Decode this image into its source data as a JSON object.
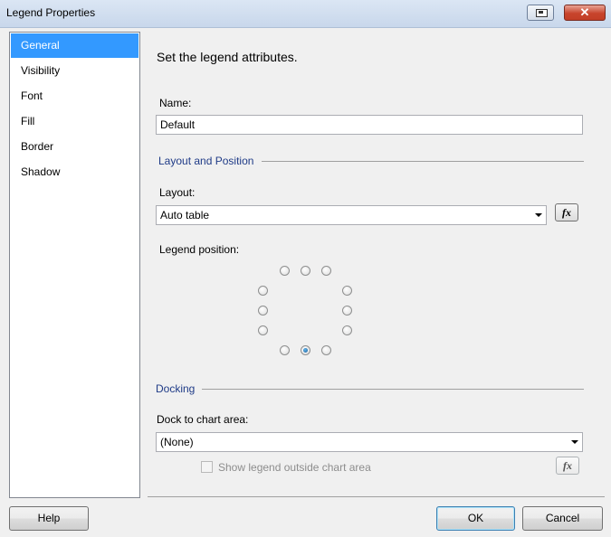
{
  "window": {
    "title": "Legend Properties"
  },
  "nav": {
    "items": [
      {
        "label": "General",
        "active": true
      },
      {
        "label": "Visibility",
        "active": false
      },
      {
        "label": "Font",
        "active": false
      },
      {
        "label": "Fill",
        "active": false
      },
      {
        "label": "Border",
        "active": false
      },
      {
        "label": "Shadow",
        "active": false
      }
    ]
  },
  "main": {
    "heading": "Set the legend attributes.",
    "name_label": "Name:",
    "name_value": "Default",
    "layout_section": "Layout and Position",
    "layout_label": "Layout:",
    "layout_value": "Auto table",
    "fx_label": "fx",
    "legend_position_label": "Legend position:",
    "legend_position_selected": "bottom-center",
    "docking_section": "Docking",
    "dock_label": "Dock to chart area:",
    "dock_value": "(None)",
    "show_outside_label": "Show legend outside chart area",
    "show_outside_checked": false
  },
  "footer": {
    "help": "Help",
    "ok": "OK",
    "cancel": "Cancel"
  }
}
